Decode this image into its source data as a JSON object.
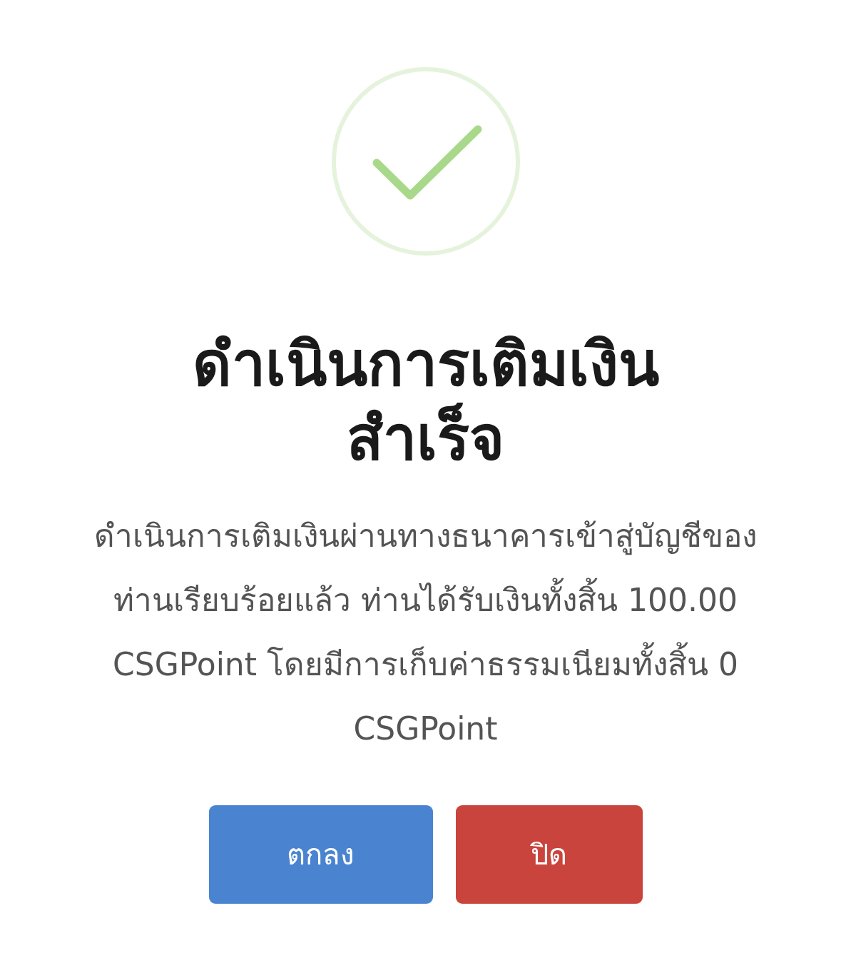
{
  "dialog": {
    "title": "ดำเนินการเติมเงินสำเร็จ",
    "message": "ดำเนินการเติมเงินผ่านทางธนาคารเข้าสู่บัญชีของท่านเรียบร้อยแล้ว ท่านได้รับเงินทั้งสิ้น 100.00 CSGPoint โดยมีการเก็บค่าธรรมเนียมทั้งสิ้น 0 CSGPoint",
    "buttons": [
      {
        "label": "ตกลง",
        "kind": "confirm"
      },
      {
        "label": "ปิด",
        "kind": "cancel"
      }
    ]
  }
}
